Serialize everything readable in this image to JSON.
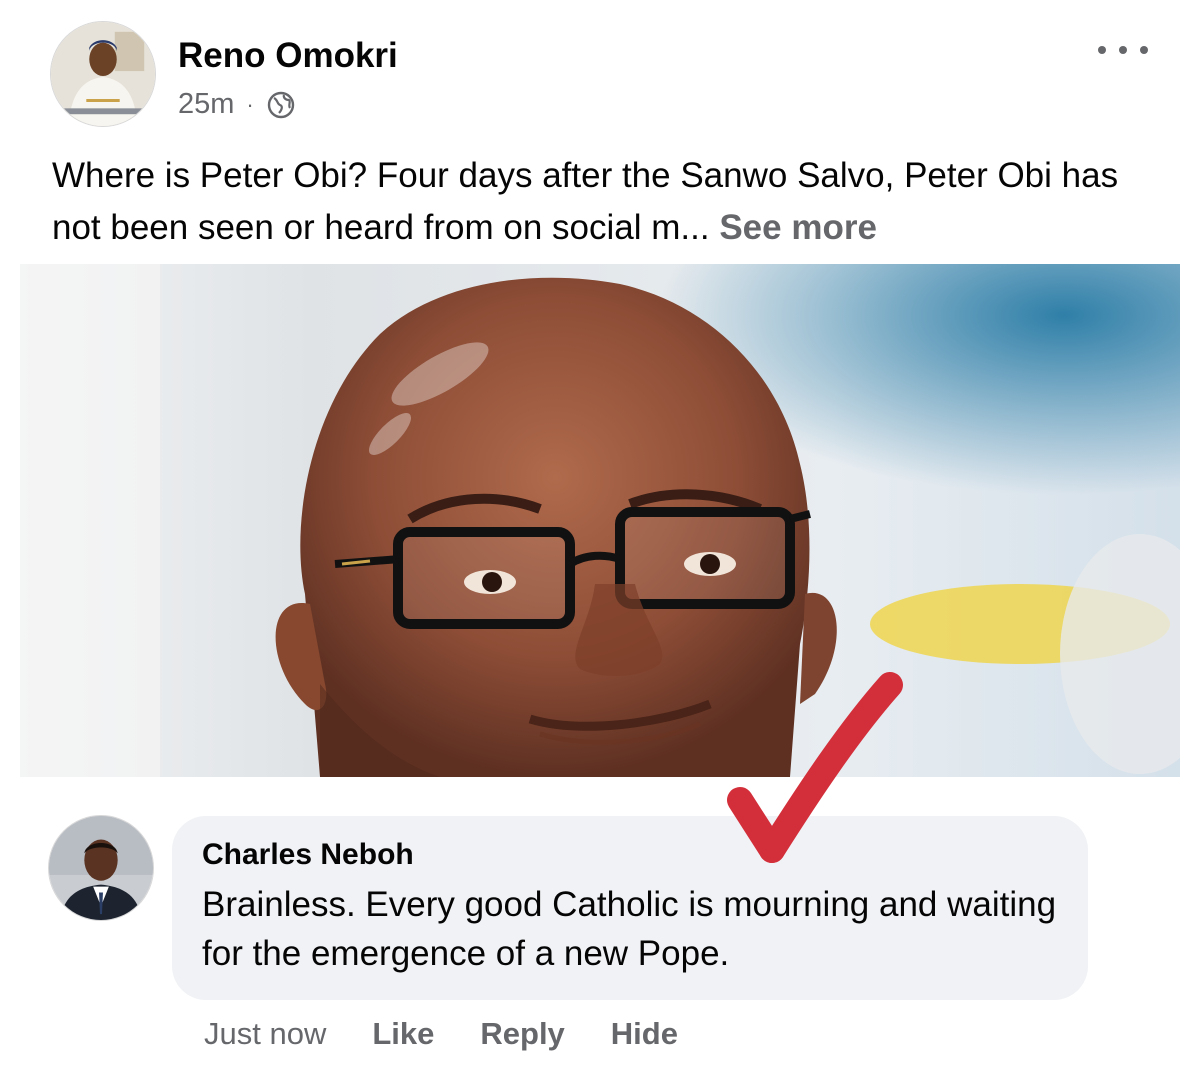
{
  "post": {
    "author_name": "Reno Omokri",
    "timestamp": "25m",
    "separator": "·",
    "audience_icon": "globe-icon",
    "text": "Where is Peter Obi? Four days after the Sanwo Salvo, Peter Obi has not been seen or heard from on social m...",
    "see_more_label": "See more",
    "options_icon": "more-options-icon"
  },
  "comment": {
    "author_name": "Charles Neboh",
    "text": "Brainless. Every good Catholic is mourning and waiting for the emergence of a new Pope.",
    "time": "Just now",
    "like_label": "Like",
    "reply_label": "Reply",
    "hide_label": "Hide"
  },
  "colors": {
    "primary_text": "#050505",
    "secondary_text": "#65676b",
    "bubble_bg": "#f0f2f5",
    "arrow": "#d32f3a"
  }
}
